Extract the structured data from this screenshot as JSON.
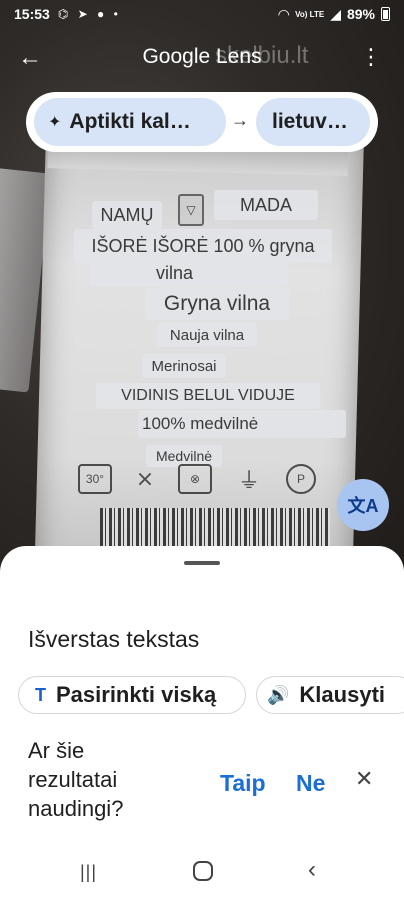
{
  "status": {
    "time": "15:53",
    "notif_icons": "⌬ ➤ ● •",
    "signal": "Vo) LTE",
    "battery": "89%"
  },
  "header": {
    "title": "Google Lens",
    "watermark": "skelbiu.lt",
    "source_lang": "Aptikti kal…",
    "target_lang": "lietuv…"
  },
  "overlay": {
    "namu": "NAMŲ",
    "mada": "MADA",
    "line1": "IŠORĖ IŠORĖ 100 % gryna",
    "line1b": "vilna",
    "gryna": "Gryna vilna",
    "nauja": "Nauja vilna",
    "merinosai": "Merinosai",
    "vidinis": "VIDINIS BELUL VIDUJE",
    "medvilne100": "100% medvilnė",
    "medvilne": "Medvilnė",
    "care_30": "30°",
    "care_p": "P"
  },
  "sheet": {
    "title": "Išverstas tekstas",
    "select_all": "Pasirinkti viską",
    "listen": "Klausyti",
    "feedback_question": "Ar šie rezultatai naudingi?",
    "yes": "Taip",
    "no": "Ne"
  },
  "icons": {
    "back": "arrow-left-icon",
    "more": "more-vert-icon",
    "sparkle": "sparkle-icon",
    "translate": "translate-icon",
    "text": "text-T-icon",
    "speaker": "speaker-icon",
    "close": "close-icon"
  }
}
